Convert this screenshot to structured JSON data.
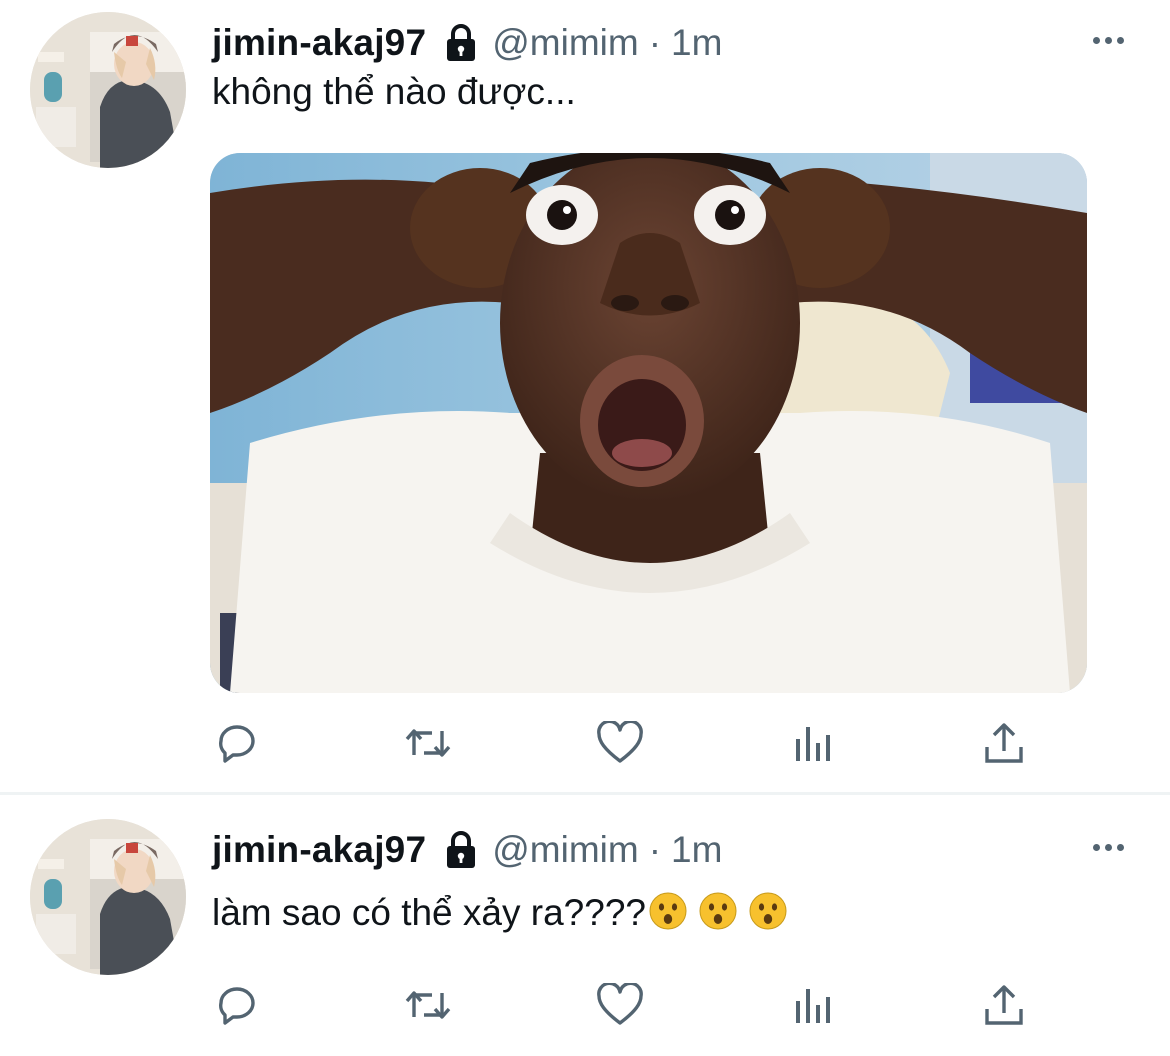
{
  "tweets": [
    {
      "display_name": "jimin-akaj97",
      "handle": "@mimim",
      "separator": "·",
      "time": "1m",
      "text": "không thể nào được...",
      "has_media": true,
      "protected_icon": "lock-icon"
    },
    {
      "display_name": "jimin-akaj97",
      "handle": "@mimim",
      "separator": "·",
      "time": "1m",
      "text": "làm sao có thể xảy ra????",
      "emoji": [
        "hushed-face",
        "hushed-face",
        "hushed-face"
      ],
      "has_media": false,
      "protected_icon": "lock-icon"
    }
  ],
  "actions": [
    "reply-icon",
    "retweet-icon",
    "like-icon",
    "analytics-icon",
    "share-icon"
  ],
  "colors": {
    "text": "#0f1419",
    "secondary": "#536471",
    "divider": "#eff3f4"
  }
}
